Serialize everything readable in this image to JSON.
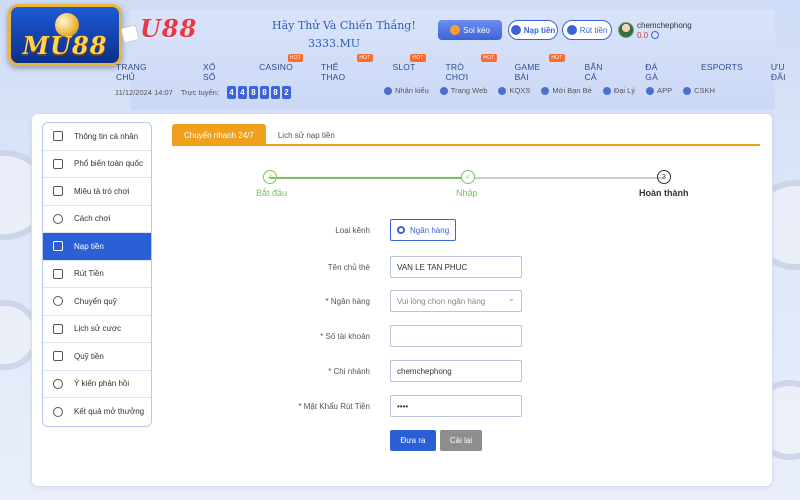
{
  "logo": {
    "text": "MU88"
  },
  "header": {
    "brand_secondary": "U88",
    "slogan": "Hãy Thử Và Chiến Thắng!",
    "domain": "3333.MU",
    "buttons": {
      "soi_keo": "Soi kèo",
      "nap_tien": "Nạp tiền",
      "rut_tien": "Rút tiền"
    },
    "user": {
      "name": "chemchephong",
      "balance": "0.0"
    }
  },
  "nav": {
    "items": [
      {
        "label": "TRANG CHỦ",
        "badge": ""
      },
      {
        "label": "XỔ SỐ",
        "badge": ""
      },
      {
        "label": "CASINO",
        "badge": "HOT"
      },
      {
        "label": "THỂ THAO",
        "badge": "HOT"
      },
      {
        "label": "SLOT",
        "badge": "HOT"
      },
      {
        "label": "TRÒ CHƠI",
        "badge": "HOT"
      },
      {
        "label": "GAME BÀI",
        "badge": "HOT"
      },
      {
        "label": "BẮN CÁ",
        "badge": ""
      },
      {
        "label": "ĐÁ GÀ",
        "badge": ""
      },
      {
        "label": "ESPORTS",
        "badge": ""
      },
      {
        "label": "ƯU ĐÃI",
        "badge": ""
      }
    ]
  },
  "ticker": {
    "datetime": "11/12/2024 14:07",
    "online_label": "Trực tuyến:",
    "digits": [
      "4",
      "4",
      "8",
      "8",
      "8",
      "2"
    ]
  },
  "links": [
    "Nhận kiểu",
    "Trang Web",
    "KQXS",
    "Mời Bạn Bè",
    "Đại Lý",
    "APP",
    "CSKH"
  ],
  "sidebar": {
    "items": [
      {
        "label": "Thông tin cá nhân"
      },
      {
        "label": "Phổ biến toàn quốc"
      },
      {
        "label": "Miêu tả trò chơi"
      },
      {
        "label": "Cách chơi"
      },
      {
        "label": "Nạp tiền"
      },
      {
        "label": "Rút Tiền"
      },
      {
        "label": "Chuyển quỹ"
      },
      {
        "label": "Lịch sử cược"
      },
      {
        "label": "Quỹ tiền"
      },
      {
        "label": "Ý kiến phản hồi"
      },
      {
        "label": "Kết quả mở thưởng"
      }
    ]
  },
  "tabs": {
    "active": "Chuyển nhanh 24/7",
    "history": "Lịch sử nạp tiền"
  },
  "stepper": {
    "step1": "Bắt đầu",
    "step2": "Nhập",
    "step3": "Hoàn thành",
    "step3_number": "3",
    "check": "✓"
  },
  "form": {
    "channel_label": "Loại kênh",
    "channel_value": "Ngân hàng",
    "holder_label": "Tên chủ thẻ",
    "holder_value": "VAN LE TAN PHUC",
    "bank_label": "* Ngân hàng",
    "bank_placeholder": "Vui lòng chọn ngân hàng",
    "account_label": "* Số tài khoản",
    "account_value": "",
    "branch_label": "* Chi nhánh",
    "branch_value": "chemchephong",
    "password_label": "* Mật Khẩu Rút Tiền",
    "password_value": "••••",
    "submit": "Đưa ra",
    "reset": "Cài lại"
  }
}
